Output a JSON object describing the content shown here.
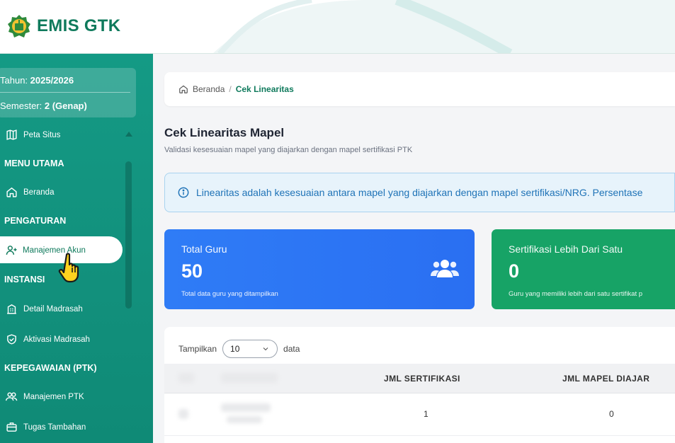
{
  "header": {
    "app_name": "EMIS GTK"
  },
  "sidebar": {
    "year_label": "Tahun: ",
    "year_value": "2025/2026",
    "semester_label": "Semester: ",
    "semester_value": "2 (Genap)",
    "sitemap": "Peta Situs",
    "sections": {
      "menu_utama": "MENU UTAMA",
      "pengaturan": "PENGATURAN",
      "instansi": "INSTANSI",
      "kepegawaian": "KEPEGAWAIAN (PTK)"
    },
    "items": {
      "beranda": "Beranda",
      "manajemen_akun": "Manajemen Akun",
      "detail_madrasah": "Detail Madrasah",
      "aktivasi_madrasah": "Aktivasi Madrasah",
      "manajemen_ptk": "Manajemen PTK",
      "tugas_tambahan": "Tugas Tambahan"
    }
  },
  "breadcrumb": {
    "home": "Beranda",
    "separator": "/",
    "current": "Cek Linearitas"
  },
  "page": {
    "title": "Cek Linearitas Mapel",
    "subtitle": "Validasi kesesuaian mapel yang diajarkan dengan mapel sertifikasi PTK"
  },
  "info": {
    "text": "Linearitas adalah kesesuaian antara mapel yang diajarkan dengan mapel sertifikasi/NRG. Persentase"
  },
  "cards": {
    "total_guru": {
      "label": "Total Guru",
      "value": "50",
      "desc": "Total data guru yang ditampilkan"
    },
    "sertifikasi": {
      "label": "Sertifikasi Lebih Dari Satu",
      "value": "0",
      "desc": "Guru yang memiliki lebih dari satu sertifikat p"
    }
  },
  "table": {
    "show_label": "Tampilkan",
    "page_size": "10",
    "show_suffix": "data",
    "headers": {
      "jml_sertifikasi": "JML SERTIFIKASI",
      "jml_mapel": "JML MAPEL DIAJAR"
    },
    "rows": [
      {
        "jml_sertifikasi": "1",
        "jml_mapel": "0"
      }
    ]
  },
  "colors": {
    "brand": "#0f7a5c",
    "sidebar": "#149a85",
    "card_blue": "#2f7cf6",
    "card_green": "#17a366",
    "info": "#1f73b7"
  }
}
